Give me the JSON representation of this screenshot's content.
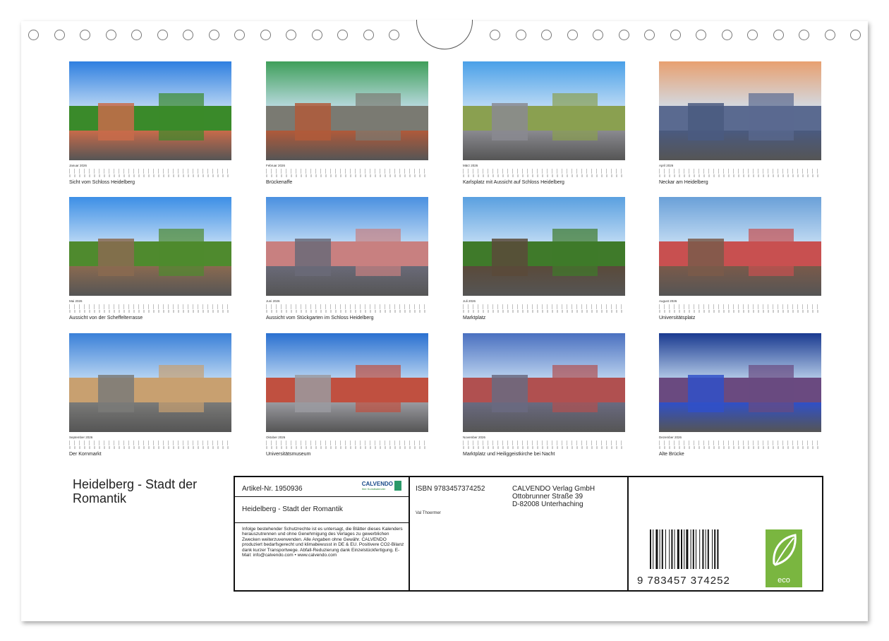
{
  "months": [
    {
      "month": "Januar 2026",
      "caption": "Sicht vom Schloss Heidelberg"
    },
    {
      "month": "Februar 2026",
      "caption": "Brückenaffe"
    },
    {
      "month": "März 2026",
      "caption": "Karlsplatz mit Aussicht auf Schloss Heidelberg"
    },
    {
      "month": "April 2026",
      "caption": "Neckar am Heidelberg"
    },
    {
      "month": "Mai 2026",
      "caption": "Aussicht von der Scheffelterrasse"
    },
    {
      "month": "Juni 2026",
      "caption": "Aussicht vom Stückgarten im Schloss Heidelberg"
    },
    {
      "month": "Juli 2026",
      "caption": "Marktplatz"
    },
    {
      "month": "August 2026",
      "caption": "Universitätsplatz"
    },
    {
      "month": "September 2026",
      "caption": "Der Kornmarkt"
    },
    {
      "month": "Oktober 2026",
      "caption": "Universitätsmuseum"
    },
    {
      "month": "November 2026",
      "caption": "Marktplatz und Heiliggeistkirche bei Nacht"
    },
    {
      "month": "Dezember 2026",
      "caption": "Alte Brücke"
    }
  ],
  "cover_title": "Heidelberg - Stadt der Romantik",
  "info": {
    "artikel": "Artikel-Nr. 1950936",
    "brand": "CALVENDO",
    "brand_sub": "Ihre Kunstkalender",
    "title": "Heidelberg - Stadt der Romantik",
    "legal": "Infolge bestehender Schutzrechte ist es untersagt, die Blätter dieses Kalenders herauszutrennen und ohne Genehmigung des Verlages zu gewerblichen Zwecken weiterzuverwenden. Alle Angaben ohne Gewähr. CALVENDO produziert bedarfsgerecht und klimabewusst in DE & EU. Positivere CO2-Bilanz dank kurzer Transportwege. Abfall-Reduzierung dank Einzelstückfertigung. E-Mail: info@calvendo.com • www.calvendo.com",
    "isbn": "ISBN 9783457374252",
    "publisher_line1": "CALVENDO Verlag GmbH",
    "publisher_line2": "Ottobrunner Straße 39",
    "publisher_line3": "D-82008 Unterhaching",
    "author": "Val Thoermer",
    "barcode_digits": "9 783457 374252",
    "eco_label": "eco"
  },
  "colors": {
    "eco_green": "#7ab640",
    "frame": "#111111"
  }
}
